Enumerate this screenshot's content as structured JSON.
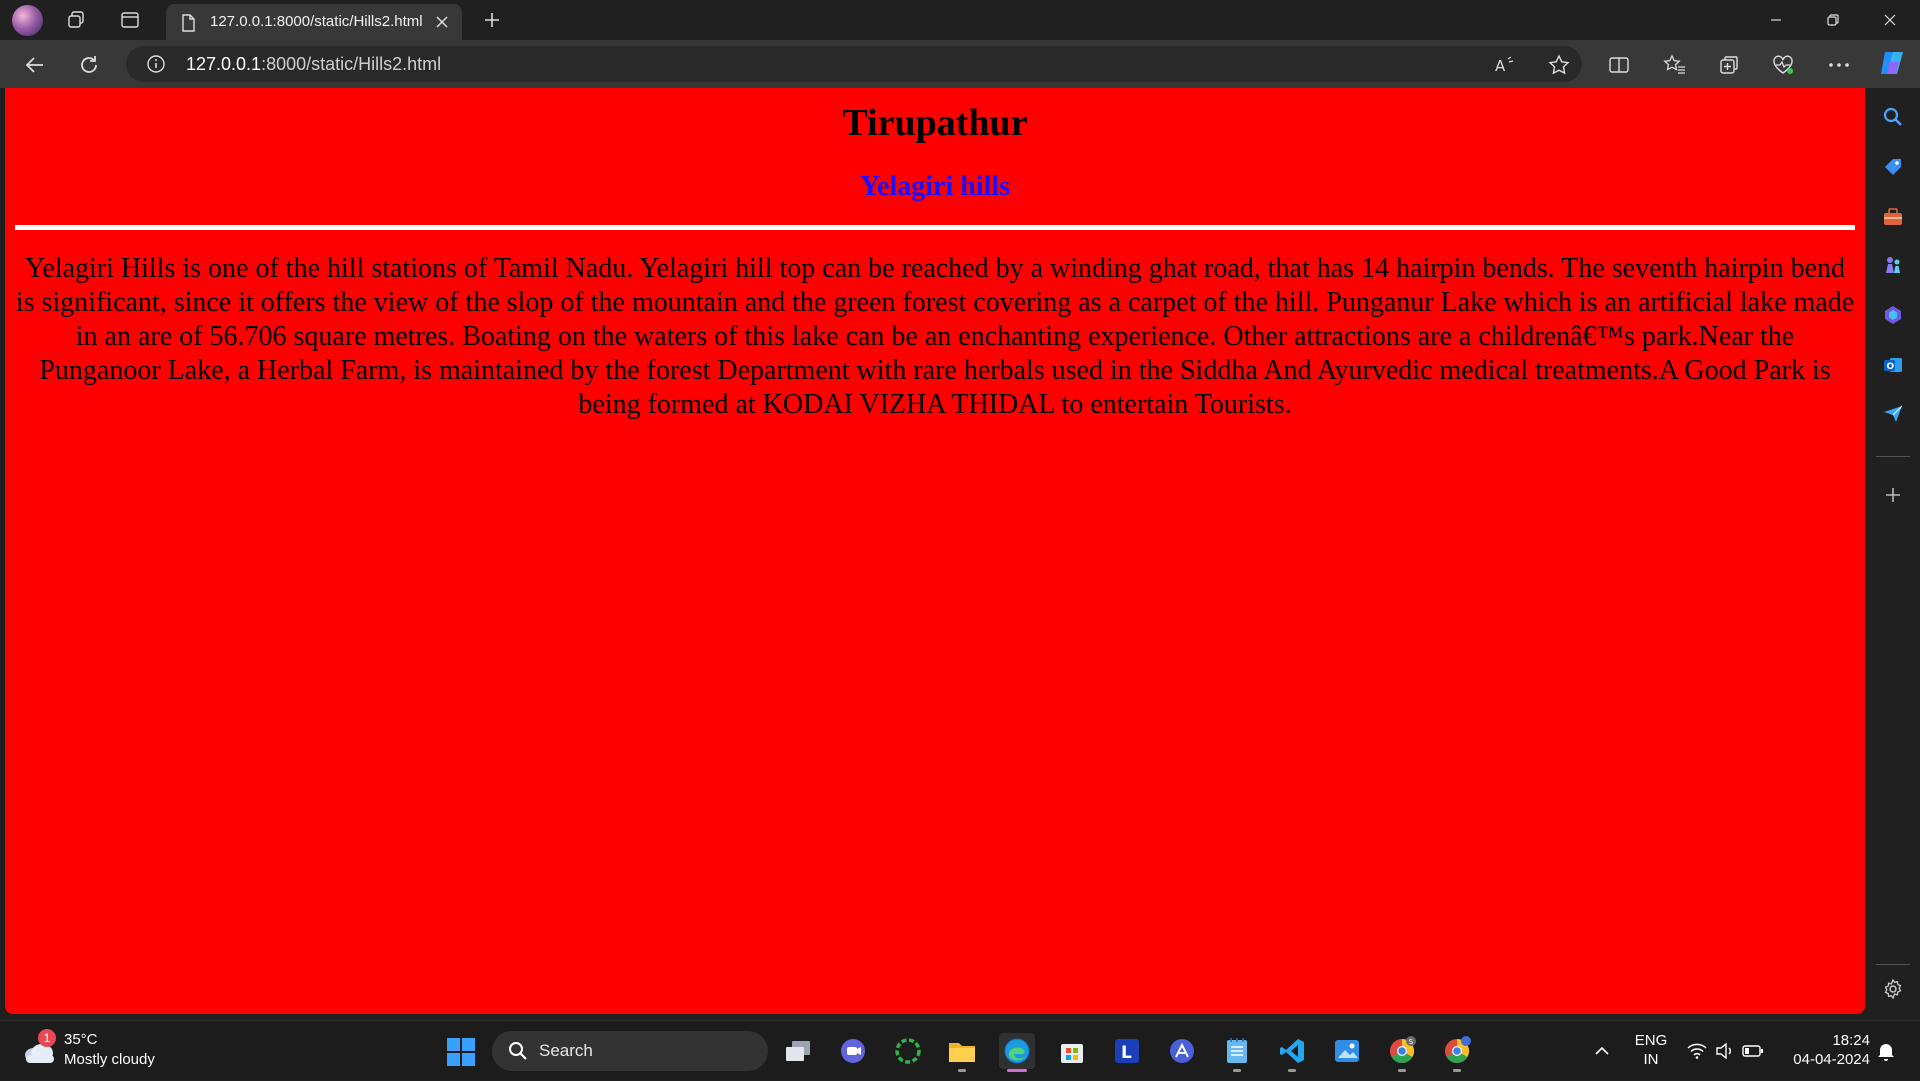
{
  "browser": {
    "tab_title": "127.0.0.1:8000/static/Hills2.html",
    "url_host": "127.0.0.1",
    "url_path": ":8000/static/Hills2.html"
  },
  "page": {
    "heading": "Tirupathur",
    "subheading": "Yelagiri hills",
    "subheading_color": "#1a10ff",
    "background_color": "#ff0000",
    "paragraph": "Yelagiri Hills is one of the hill stations of Tamil Nadu. Yelagiri hill top can be reached by a winding ghat road, that has 14 hairpin bends. The seventh hairpin bend is significant, since it offers the view of the slop of the mountain and the green forest covering as a carpet of the hill. Punganur Lake which is an artificial lake made in an are of 56.706 square metres. Boating on the waters of this lake can be an enchanting experience. Other attractions are a childrenâ€™s park.Near the Punganoor Lake, a Herbal Farm, is maintained by the forest Department with rare herbals used in the Siddha And Ayurvedic medical treatments.A Good Park is being formed at KODAI VIZHA THIDAL to entertain Tourists."
  },
  "taskbar": {
    "weather_badge": "1",
    "weather_temp": "35°C",
    "weather_desc": "Mostly cloudy",
    "search_label": "Search",
    "lang_line1": "ENG",
    "lang_line2": "IN",
    "time": "18:24",
    "date": "04-04-2024"
  }
}
